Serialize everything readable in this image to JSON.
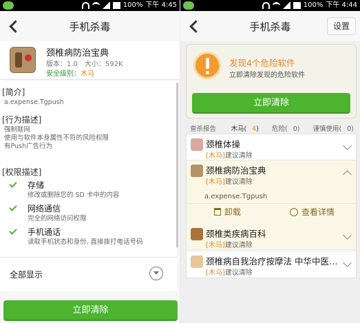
{
  "status_bar": {
    "battery": "100%",
    "left_time": "下午 4:45",
    "right_time": "下午 4:44"
  },
  "left": {
    "title": "手机杀毒",
    "app": {
      "name": "颈椎病防治宝典",
      "version": "版本：1.0",
      "size": "大小：592K",
      "safety_label": "安全级别：",
      "safety_value": "木马"
    },
    "intro": {
      "title": "[简介]",
      "text": "a.expense.Tgpush"
    },
    "behavior": {
      "title": "[行为描述]",
      "lines": [
        "强制联网",
        "使用与软件本身属性不符的风险权限",
        "有Push广告行为"
      ]
    },
    "permissions": {
      "title": "[权限描述]",
      "items": [
        {
          "name": "存储",
          "desc": "修改或删除您的 SD 卡中的内容"
        },
        {
          "name": "网络通信",
          "desc": "完全的网络访问权限"
        },
        {
          "name": "手机通话",
          "desc": "读取手机状态和身份, 直接拨打电话号码"
        }
      ]
    },
    "show_all": "全部显示",
    "clean_button": "立即清除"
  },
  "right": {
    "title": "手机杀毒",
    "settings": "设置",
    "alert": {
      "title": "发现4个危险软件",
      "subtitle": "立即清除发现的危险软件"
    },
    "clean_button": "立即清除",
    "report": {
      "title": "查杀报告",
      "filters": [
        {
          "label": "木马",
          "count": "4"
        },
        {
          "label": "危险",
          "count": "0"
        },
        {
          "label": "谨慎使用",
          "count": "0"
        }
      ]
    },
    "items": [
      {
        "name": "颈椎体操",
        "tag": "[木马]",
        "advice": "建议清除"
      },
      {
        "name": "颈椎病防治宝典",
        "tag": "[木马]",
        "advice": "建议清除",
        "package": "a.expense.Tgpush",
        "uninstall": "卸载",
        "details": "查看详情"
      },
      {
        "name": "颈椎类疾病百科",
        "tag": "[木马]",
        "advice": "建议清除"
      },
      {
        "name": "颈椎病自我治疗按摩法 中华中医…",
        "tag": "[木马]",
        "advice": "建议清除"
      }
    ]
  },
  "colors": {
    "accent_green": "#4cb42f",
    "warning_orange": "#e8862a",
    "check_green": "#55b033"
  },
  "icons": [
    "back-arrow-icon",
    "check-icon",
    "chevron-down-icon",
    "chevron-up-icon",
    "warning-icon",
    "trash-icon",
    "more-icon"
  ]
}
